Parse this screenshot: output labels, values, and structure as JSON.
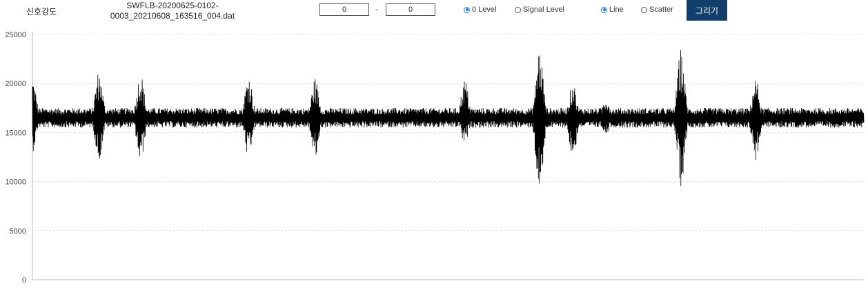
{
  "toolbar": {
    "title": "신호강도",
    "filename_line1": "SWFLB-20200625-0102-",
    "filename_line2": "0003_20210608_163516_004.dat",
    "range_start": "0",
    "range_sep": "-",
    "range_end": "0",
    "level_options": [
      {
        "label": "0 Level",
        "checked": true
      },
      {
        "label": "Signal Level",
        "checked": false
      }
    ],
    "plot_options": [
      {
        "label": "Line",
        "checked": true
      },
      {
        "label": "Scatter",
        "checked": false
      }
    ],
    "draw_label": "그리기"
  },
  "chart_data": {
    "type": "line",
    "title": "",
    "xlabel": "",
    "ylabel": "",
    "ylim": [
      0,
      25000
    ],
    "yticks": [
      "0",
      "5000",
      "10000",
      "15000",
      "20000",
      "25000"
    ],
    "grid": true,
    "baseline": 16500,
    "noise_amplitude": 1000,
    "color": "#000000",
    "bursts": [
      {
        "at": 0.0,
        "max": 20700,
        "min": 13000
      },
      {
        "at": 0.08,
        "max": 21400,
        "min": 12100
      },
      {
        "at": 0.13,
        "max": 21200,
        "min": 11800
      },
      {
        "at": 0.26,
        "max": 21000,
        "min": 12200
      },
      {
        "at": 0.34,
        "max": 20600,
        "min": 12200
      },
      {
        "at": 0.52,
        "max": 20500,
        "min": 13700
      },
      {
        "at": 0.61,
        "max": 23800,
        "min": 8500
      },
      {
        "at": 0.65,
        "max": 20200,
        "min": 12300
      },
      {
        "at": 0.69,
        "max": 18700,
        "min": 14700
      },
      {
        "at": 0.78,
        "max": 23600,
        "min": 9500
      },
      {
        "at": 0.87,
        "max": 20600,
        "min": 12100
      }
    ]
  }
}
